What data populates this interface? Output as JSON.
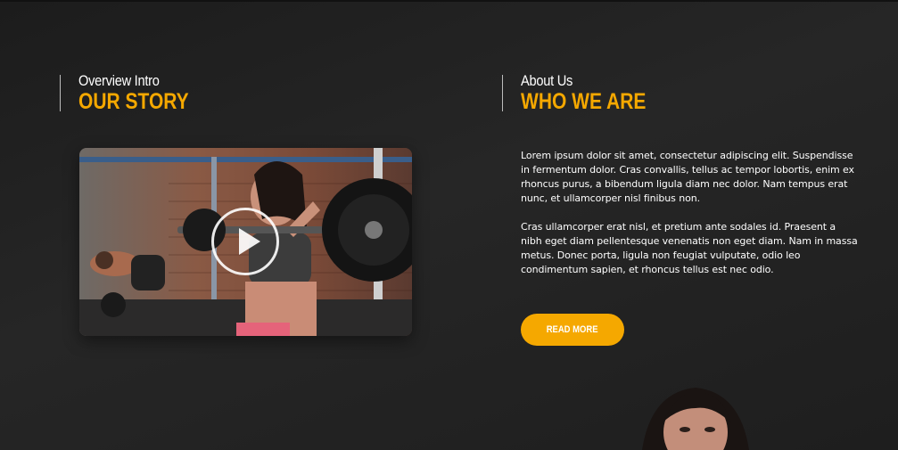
{
  "overview": {
    "eyebrow": "Overview Intro",
    "title": "OUR STORY"
  },
  "about": {
    "eyebrow": "About Us",
    "title": "WHO WE ARE",
    "paragraph_1": "Lorem ipsum dolor sit amet, consectetur adipiscing elit. Suspendisse in fermentum dolor. Cras convallis, tellus ac tempor lobortis, enim ex rhoncus purus, a bibendum ligula diam nec dolor. Nam tempus erat nunc, et ullamcorper nisl finibus non.",
    "paragraph_2": "Cras ullamcorper erat nisl, et pretium ante sodales id. Praesent a nibh eget diam pellentesque venenatis non eget diam. Nam in massa metus. Donec porta, ligula non feugiat vulputate, odio leo condimentum sapien, et rhoncus tellus est nec odio.",
    "button_label": "READ MORE"
  },
  "icons": {
    "play": "play-icon"
  },
  "colors": {
    "accent": "#f5a800",
    "background": "#222222",
    "text": "#ffffff"
  }
}
